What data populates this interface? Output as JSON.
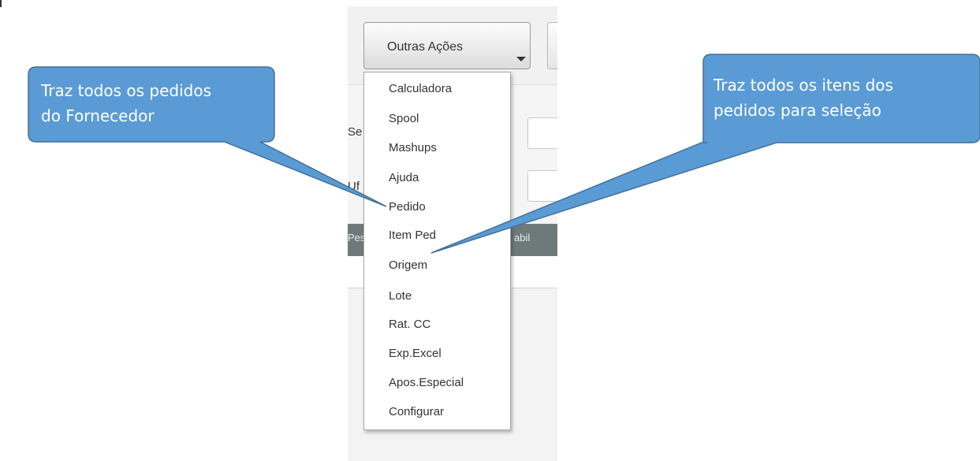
{
  "toolbar": {
    "actions_button_label": "Outras Ações"
  },
  "form": {
    "label_1": "Se",
    "label_2": "Uf"
  },
  "grid": {
    "header_left": "Pes",
    "header_right": "abil"
  },
  "dropdown": {
    "items": [
      "Calculadora",
      "Spool",
      "Mashups",
      "Ajuda",
      "Pedido",
      "Item Ped",
      "Origem",
      "Lote",
      "Rat. CC",
      "Exp.Excel",
      "Apos.Especial",
      "Configurar"
    ]
  },
  "callouts": {
    "left": {
      "line1": "Traz todos os pedidos",
      "line2": "do Fornecedor"
    },
    "right": {
      "line1": "Traz todos os itens dos",
      "line2": "pedidos para seleção"
    }
  },
  "colors": {
    "callout_fill": "#5b9bd5",
    "callout_border": "#41719c",
    "grid_header": "#6e7a7a"
  }
}
